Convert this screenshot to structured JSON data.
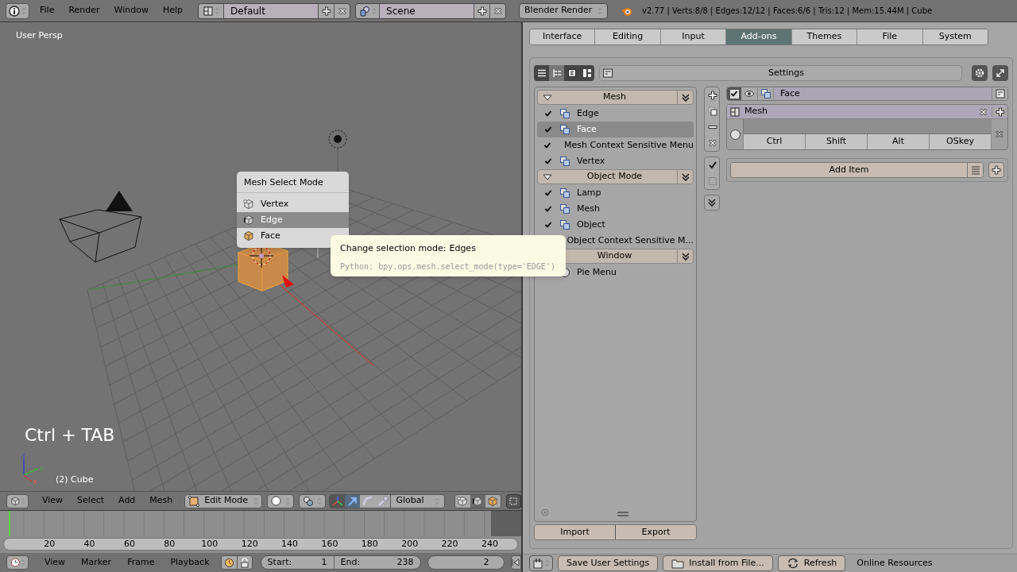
{
  "top_bar": {
    "menus": [
      "File",
      "Render",
      "Window",
      "Help"
    ],
    "screen_layout": "Default",
    "scene": "Scene",
    "render_engine": "Blender Render",
    "stats": "v2.77 | Verts:8/8 | Edges:12/12 | Faces:6/6 | Tris:12 | Mem:15.44M | Cube"
  },
  "viewport": {
    "view_name": "User Persp",
    "shortcut": "Ctrl + TAB",
    "object_name": "(2) Cube",
    "axis_labels": [
      "z",
      "y",
      "x"
    ],
    "select_menu": {
      "title": "Mesh Select Mode",
      "items": [
        {
          "label": "Vertex",
          "kind": "vertex",
          "selected": false
        },
        {
          "label": "Edge",
          "kind": "edge",
          "selected": true
        },
        {
          "label": "Face",
          "kind": "face",
          "selected": false
        }
      ]
    },
    "tooltip": {
      "label": "Change selection mode:",
      "value": "Edges",
      "python": "Python: bpy.ops.mesh.select_mode(type='EDGE')"
    }
  },
  "viewport_header": {
    "menus": [
      "View",
      "Select",
      "Add",
      "Mesh"
    ],
    "mode": "Edit Mode",
    "orientation": "Global",
    "select_modes": [
      {
        "kind": "vertex",
        "selected": false
      },
      {
        "kind": "edge",
        "selected": true
      },
      {
        "kind": "face",
        "selected": false
      }
    ]
  },
  "timeline": {
    "ticks": [
      "20",
      "40",
      "60",
      "80",
      "100",
      "120",
      "140",
      "160",
      "180",
      "200",
      "220",
      "240"
    ],
    "menus": [
      "View",
      "Marker",
      "Frame",
      "Playback"
    ],
    "start_label": "Start:",
    "start": "1",
    "end_label": "End:",
    "end": "238",
    "current_frame": "2"
  },
  "preferences": {
    "tabs": [
      {
        "label": "Interface",
        "selected": false
      },
      {
        "label": "Editing",
        "selected": false
      },
      {
        "label": "Input",
        "selected": false
      },
      {
        "label": "Add-ons",
        "selected": true
      },
      {
        "label": "Themes",
        "selected": false
      },
      {
        "label": "File",
        "selected": false
      },
      {
        "label": "System",
        "selected": false
      }
    ],
    "settings_label": "Settings",
    "categories": [
      {
        "name": "Mesh",
        "expanded": true,
        "items": [
          {
            "label": "Edge",
            "kind": "keymap",
            "checked": true,
            "selected": false
          },
          {
            "label": "Face",
            "kind": "keymap",
            "checked": true,
            "selected": true
          },
          {
            "label": "Mesh Context Sensitive Menu",
            "kind": "pie",
            "checked": true,
            "selected": false
          },
          {
            "label": "Vertex",
            "kind": "keymap",
            "checked": true,
            "selected": false
          }
        ]
      },
      {
        "name": "Object Mode",
        "expanded": true,
        "items": [
          {
            "label": "Lamp",
            "kind": "keymap",
            "checked": true,
            "selected": false
          },
          {
            "label": "Mesh",
            "kind": "keymap",
            "checked": true,
            "selected": false
          },
          {
            "label": "Object",
            "kind": "keymap",
            "checked": true,
            "selected": false
          },
          {
            "label": "Object Context Sensitive M...",
            "kind": "none",
            "selected": false
          }
        ]
      },
      {
        "name": "Window",
        "items": [
          {
            "label": "Pie Menu",
            "kind": "radio",
            "selected": false
          }
        ]
      }
    ],
    "keymap_item": {
      "name": "Face",
      "checked": true,
      "radio_selected": false,
      "submenu": "Mesh",
      "modifiers": [
        "Ctrl",
        "Shift",
        "Alt",
        "OSkey"
      ]
    },
    "add_item": "Add Item",
    "import": "Import",
    "export": "Export"
  },
  "footer": {
    "buttons": [
      {
        "label": "Save User Settings",
        "kind": "plain"
      },
      {
        "label": "Install from File...",
        "kind": "folder"
      },
      {
        "label": "Refresh",
        "kind": "refresh"
      }
    ],
    "link": "Online Resources"
  }
}
